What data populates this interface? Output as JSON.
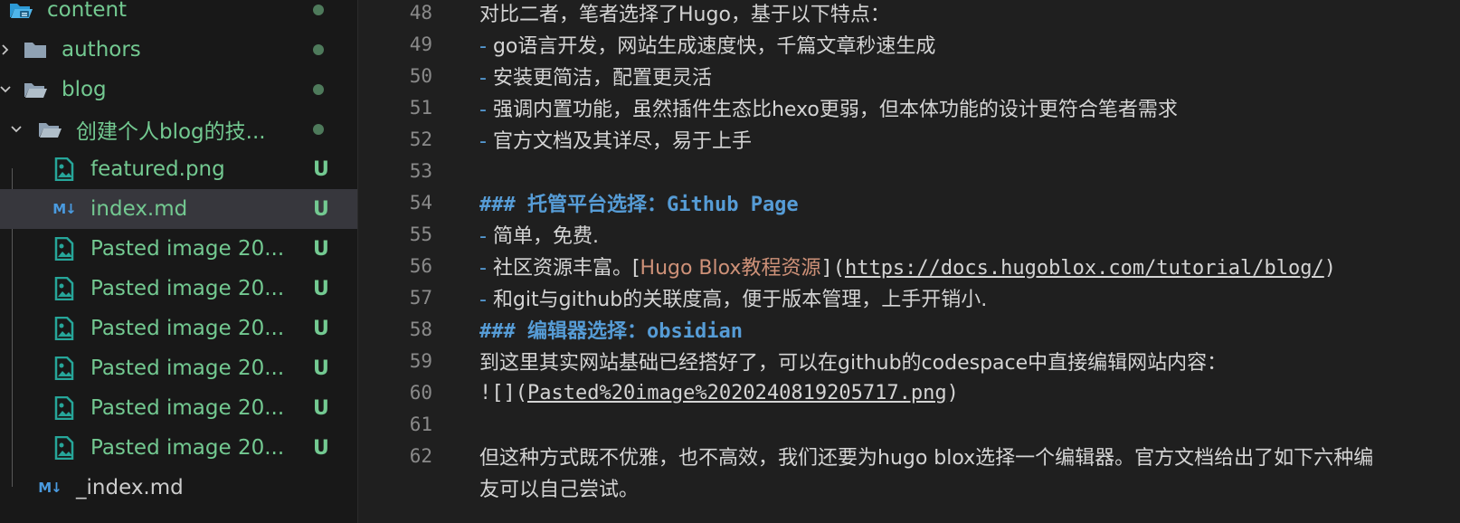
{
  "sidebar": {
    "items": [
      {
        "label": "content",
        "status": "dot",
        "kind": "folder-special",
        "state": "open"
      },
      {
        "label": "authors",
        "status": "dot",
        "kind": "folder",
        "state": "closed"
      },
      {
        "label": "blog",
        "status": "dot",
        "kind": "folder",
        "state": "open"
      },
      {
        "label": "创建个人blog的技...",
        "status": "dot",
        "kind": "folder",
        "state": "open"
      },
      {
        "label": "featured.png",
        "status": "U",
        "kind": "image"
      },
      {
        "label": "index.md",
        "status": "U",
        "kind": "markdown",
        "selected": true
      },
      {
        "label": "Pasted image 20...",
        "status": "U",
        "kind": "image"
      },
      {
        "label": "Pasted image 20...",
        "status": "U",
        "kind": "image"
      },
      {
        "label": "Pasted image 20...",
        "status": "U",
        "kind": "image"
      },
      {
        "label": "Pasted image 20...",
        "status": "U",
        "kind": "image"
      },
      {
        "label": "Pasted image 20...",
        "status": "U",
        "kind": "image"
      },
      {
        "label": "Pasted image 20...",
        "status": "U",
        "kind": "image"
      },
      {
        "label": "_index.md",
        "status": "",
        "kind": "markdown"
      }
    ],
    "md_icon": "M↓"
  },
  "editor": {
    "lines": [
      {
        "num": "48",
        "text": "对比二者，笔者选择了Hugo，基于以下特点："
      },
      {
        "num": "49",
        "dash": "-",
        "text": " go语言开发，网站生成速度快，千篇文章秒速生成"
      },
      {
        "num": "50",
        "dash": "-",
        "text": " 安装更简洁，配置更灵活"
      },
      {
        "num": "51",
        "dash": "-",
        "text": " 强调内置功能，虽然插件生态比hexo更弱，但本体功能的设计更符合笔者需求"
      },
      {
        "num": "52",
        "dash": "-",
        "text": " 官方文档及其详尽，易于上手"
      },
      {
        "num": "53",
        "text": ""
      },
      {
        "num": "54",
        "heading": "### 托管平台选择：Github Page"
      },
      {
        "num": "55",
        "dash": "-",
        "text": " 简单，免费."
      },
      {
        "num": "56",
        "dash": "-",
        "text": " 社区资源丰富。[",
        "link_text": "Hugo Blox教程资源",
        "mid": "](",
        "url": "https://docs.hugoblox.com/tutorial/blog/",
        "tail": ")"
      },
      {
        "num": "57",
        "dash": "-",
        "text": " 和git与github的关联度高，便于版本管理，上手开销小."
      },
      {
        "num": "58",
        "heading": "### 编辑器选择：obsidian"
      },
      {
        "num": "59",
        "text": "到这里其实网站基础已经搭好了，可以在github的codespace中直接编辑网站内容："
      },
      {
        "num": "60",
        "prefix": "![](",
        "url": "Pasted%20image%2020240819205717.png",
        "tail": ")"
      },
      {
        "num": "61",
        "text": ""
      },
      {
        "num": "62",
        "text": "但这种方式既不优雅，也不高效，我们还要为hugo blox选择一个编辑器。官方文档给出了如下六种编"
      },
      {
        "num": "",
        "text": "友可以自己尝试。"
      }
    ]
  },
  "colors": {
    "sidebar_bg": "#181818",
    "editor_bg": "#1f1f1f",
    "git_green": "#73c991",
    "heading_blue": "#569cd6",
    "link_orange": "#ce9178",
    "selection": "#37373d"
  }
}
